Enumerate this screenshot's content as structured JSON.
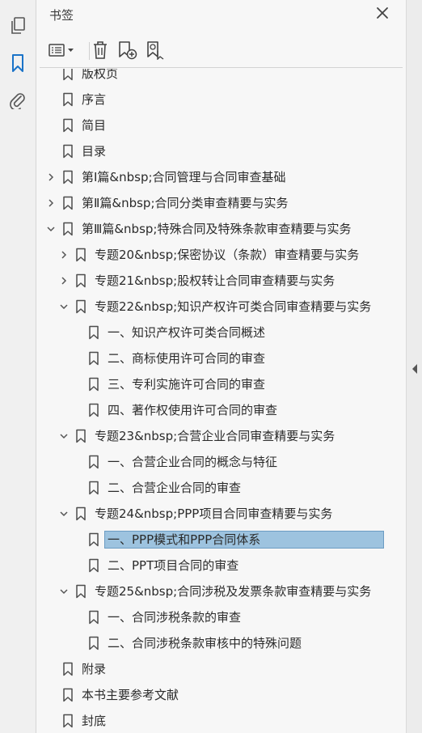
{
  "panel": {
    "title": "书签"
  },
  "icons": {
    "rail": [
      "pages-icon",
      "bookmark-icon",
      "attachment-icon"
    ],
    "toolbar": [
      "options-menu-icon",
      "delete-bookmark-icon",
      "new-bookmark-icon",
      "find-bookmark-icon"
    ]
  },
  "colors": {
    "accent": "#1a73c8",
    "selection": "#9dc3df",
    "selection_border": "#6b9cc3",
    "scroll_thumb": "#c1c1c1"
  },
  "bookmarks": [
    {
      "label": "版权页",
      "level": 0,
      "expander": "none",
      "partial": true
    },
    {
      "label": "序言",
      "level": 0,
      "expander": "none"
    },
    {
      "label": "简目",
      "level": 0,
      "expander": "none"
    },
    {
      "label": "目录",
      "level": 0,
      "expander": "none"
    },
    {
      "label": "第Ⅰ篇&nbsp;合同管理与合同审查基础",
      "level": 0,
      "expander": "collapsed"
    },
    {
      "label": "第Ⅱ篇&nbsp;合同分类审查精要与实务",
      "level": 0,
      "expander": "collapsed"
    },
    {
      "label": "第Ⅲ篇&nbsp;特殊合同及特殊条款审查精要与实务",
      "level": 0,
      "expander": "expanded"
    },
    {
      "label": "专题20&nbsp;保密协议（条款）审查精要与实务",
      "level": 1,
      "expander": "collapsed"
    },
    {
      "label": "专题21&nbsp;股权转让合同审查精要与实务",
      "level": 1,
      "expander": "collapsed"
    },
    {
      "label": "专题22&nbsp;知识产权许可类合同审查精要与实务",
      "level": 1,
      "expander": "expanded"
    },
    {
      "label": "一、知识产权许可类合同概述",
      "level": 2,
      "expander": "none"
    },
    {
      "label": "二、商标使用许可合同的审查",
      "level": 2,
      "expander": "none"
    },
    {
      "label": "三、专利实施许可合同的审查",
      "level": 2,
      "expander": "none"
    },
    {
      "label": "四、著作权使用许可合同的审查",
      "level": 2,
      "expander": "none"
    },
    {
      "label": "专题23&nbsp;合营企业合同审查精要与实务",
      "level": 1,
      "expander": "expanded"
    },
    {
      "label": "一、合营企业合同的概念与特征",
      "level": 2,
      "expander": "none"
    },
    {
      "label": "二、合营企业合同的审查",
      "level": 2,
      "expander": "none"
    },
    {
      "label": "专题24&nbsp;PPP项目合同审查精要与实务",
      "level": 1,
      "expander": "expanded"
    },
    {
      "label": "一、PPP模式和PPP合同体系",
      "level": 2,
      "expander": "none",
      "selected": true
    },
    {
      "label": "二、PPT项目合同的审查",
      "level": 2,
      "expander": "none"
    },
    {
      "label": "专题25&nbsp;合同涉税及发票条款审查精要与实务",
      "level": 1,
      "expander": "expanded"
    },
    {
      "label": "一、合同涉税条款的审查",
      "level": 2,
      "expander": "none"
    },
    {
      "label": "二、合同涉税条款审核中的特殊问题",
      "level": 2,
      "expander": "none"
    },
    {
      "label": "附录",
      "level": 0,
      "expander": "none"
    },
    {
      "label": "本书主要参考文献",
      "level": 0,
      "expander": "none"
    },
    {
      "label": "封底",
      "level": 0,
      "expander": "none"
    }
  ]
}
